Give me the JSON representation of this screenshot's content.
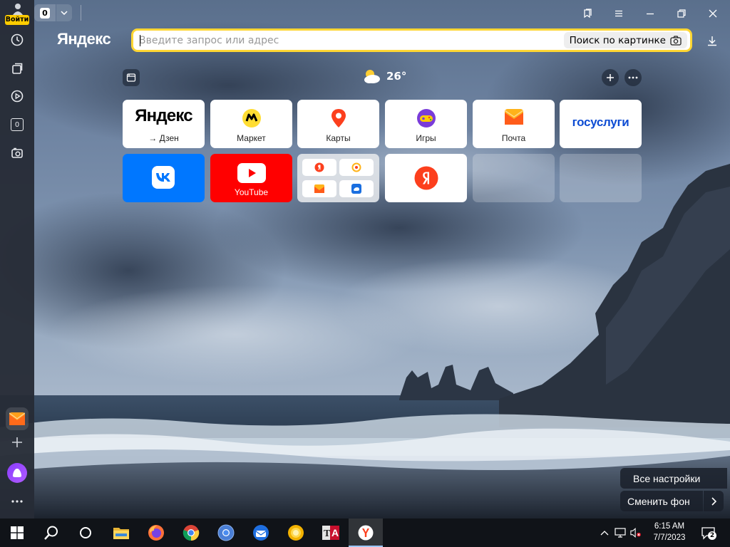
{
  "sidebar": {
    "login_label": "Войти",
    "tabs_badge": "0"
  },
  "topbar": {
    "tab_count": "0"
  },
  "brand": "Яндекс",
  "omnibox": {
    "placeholder": "Введите запрос или адрес",
    "value": "",
    "image_search_label": "Поиск по картинке"
  },
  "weather": {
    "temperature": "26°",
    "icon": "partly-cloudy-icon"
  },
  "tiles": [
    {
      "id": "yandex-dzen",
      "logo_text": "Яндекс",
      "label": "→ Дзен"
    },
    {
      "id": "market",
      "label": "Маркет"
    },
    {
      "id": "maps",
      "label": "Карты"
    },
    {
      "id": "games",
      "label": "Игры"
    },
    {
      "id": "mail",
      "label": "Почта"
    },
    {
      "id": "gosuslugi",
      "logo_text": "госуслуги"
    },
    {
      "id": "vk"
    },
    {
      "id": "youtube",
      "label": "YouTube"
    },
    {
      "id": "group"
    },
    {
      "id": "yandex"
    },
    {
      "id": "empty-1"
    },
    {
      "id": "empty-2"
    }
  ],
  "bottom_actions": {
    "all_settings": "Все настройки",
    "change_background": "Сменить фон"
  },
  "taskbar": {
    "time": "6:15 AM",
    "date": "7/7/2023",
    "notifications": "2"
  },
  "colors": {
    "accent_yellow": "#ffd633",
    "yandex_red": "#fc3f1d",
    "vk_blue": "#0077ff",
    "youtube_red": "#ff0000",
    "alice_purple": "#8a3cff"
  }
}
